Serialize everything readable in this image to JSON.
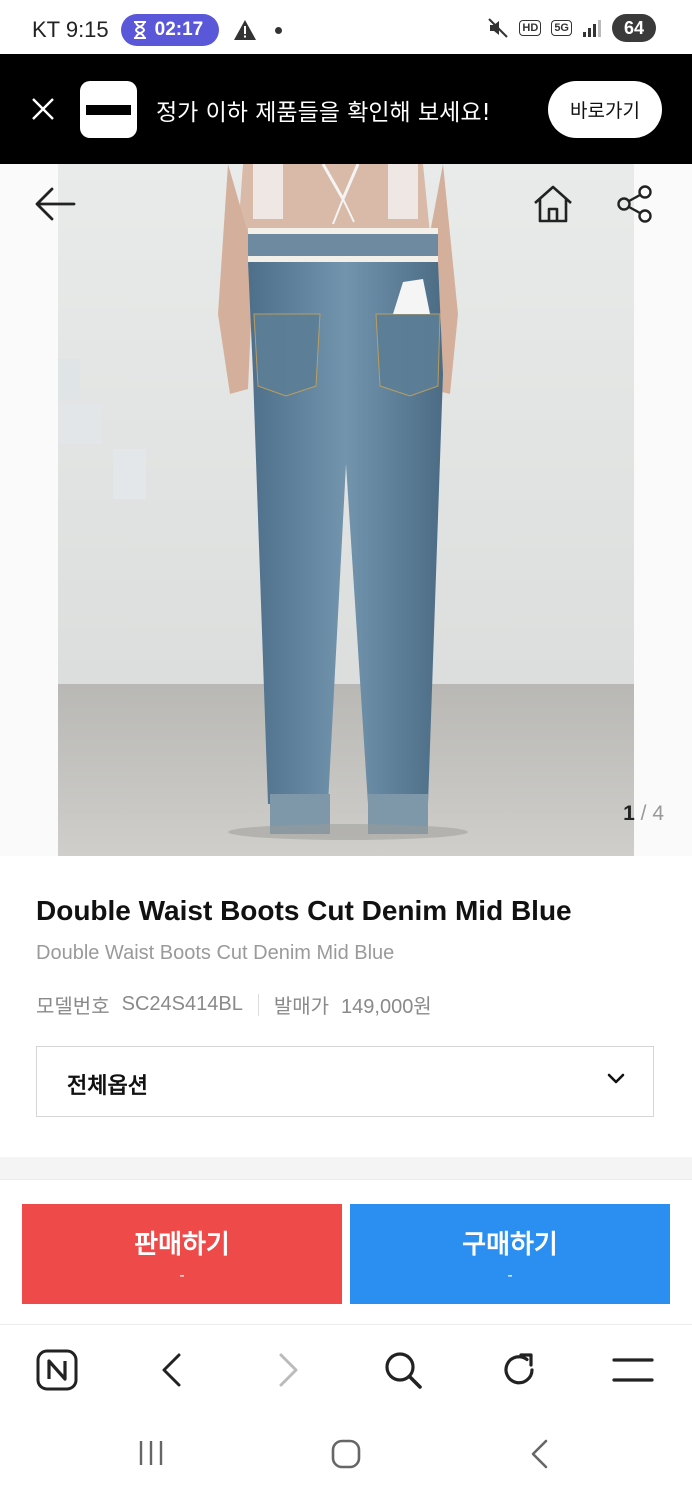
{
  "status_bar": {
    "carrier_time": "KT 9:15",
    "timer": "02:17",
    "battery": "64",
    "network_badge_hd": "HD",
    "network_badge_5g": "5G"
  },
  "promo": {
    "text": "정가 이하 제품들을 확인해 보세요!",
    "button_label": "바로가기"
  },
  "gallery": {
    "current": "1",
    "separator": "/",
    "total": "4"
  },
  "product": {
    "title": "Double Waist Boots Cut Denim Mid Blue",
    "subtitle": "Double Waist Boots Cut Denim Mid Blue",
    "model_label": "모델번호",
    "model_value": "SC24S414BL",
    "release_label": "발매가",
    "release_value": "149,000원",
    "option_label": "전체옵션"
  },
  "actions": {
    "sell_label": "판매하기",
    "sell_sub": "-",
    "buy_label": "구매하기",
    "buy_sub": "-"
  },
  "colors": {
    "accent_purple": "#5b57d9",
    "sell_red": "#ef4a4a",
    "buy_blue": "#2a8ff0"
  },
  "icons": {
    "back": "arrow-left-icon",
    "home": "home-icon",
    "share": "share-icon",
    "close": "close-icon"
  }
}
